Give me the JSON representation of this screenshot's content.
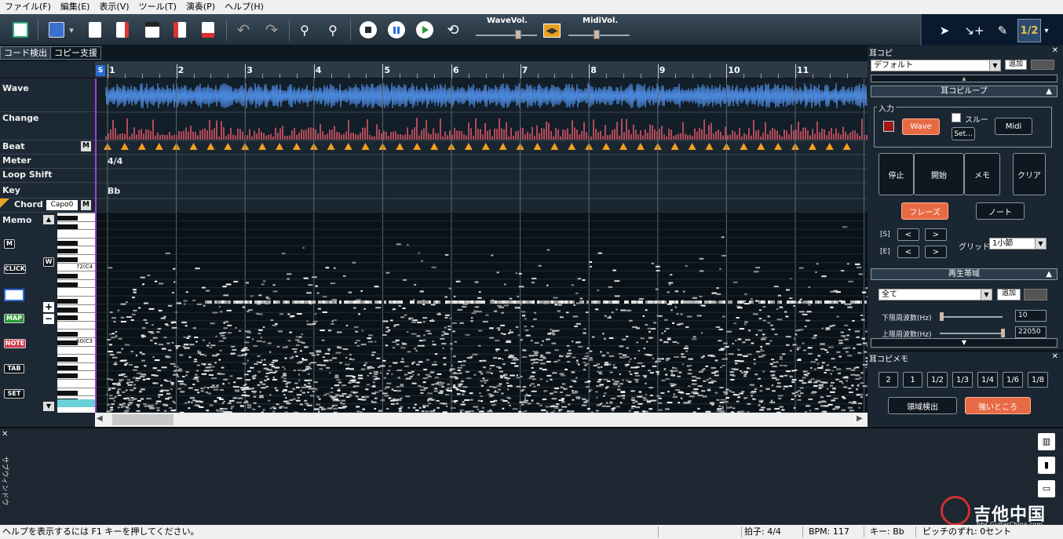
{
  "menu": [
    "ファイル(F)",
    "編集(E)",
    "表示(V)",
    "ツール(T)",
    "演奏(P)",
    "ヘルプ(H)"
  ],
  "toolbar": {
    "wave_vol_label": "WaveVol.",
    "midi_vol_label": "MidiVol.",
    "wave_vol_level": 0.72,
    "midi_vol_level": 0.45
  },
  "right_tools": {
    "half_label": "1/2"
  },
  "tabs": [
    "コード検出",
    "コピー支援"
  ],
  "ruler": {
    "start_marker": "S",
    "measures": [
      "1",
      "2",
      "3",
      "4",
      "5",
      "6",
      "7",
      "8",
      "9",
      "10",
      "11"
    ]
  },
  "tracks": {
    "wave": "Wave",
    "change": "Change",
    "beat": "Beat",
    "meter": "Meter",
    "loop_shift": "Loop Shift",
    "key": "Key",
    "chord": "Chord",
    "capo": "Capo0",
    "memo": "Memo",
    "m_label": "M",
    "meter_value": "4/4",
    "key_value": "Bb"
  },
  "side_buttons": {
    "m": "M",
    "w": "W",
    "click": "CLICK",
    "map": "MAP",
    "note": "NOTE",
    "tab": "TAB",
    "set": "SET",
    "plus": "+",
    "minus": "−"
  },
  "piano": {
    "c4": "72(C4",
    "c3": "60(C3"
  },
  "colors": {
    "wave": "#4a86d8",
    "change": "#e85a6a",
    "beat": "#f0a020",
    "accent": "#e86a44"
  },
  "mimicopi": {
    "title": "耳コピ",
    "preset": "デフォルト",
    "add": "追加",
    "loop_title": "耳コピループ",
    "input_label": "入力",
    "wave_btn": "Wave",
    "through_label": "スルー",
    "set_btn": "Set...",
    "midi_btn": "Midi",
    "stop": "停止",
    "start": "開始",
    "memo": "メモ",
    "clear": "クリア",
    "phrase": "フレーズ",
    "note": "ノート",
    "s_label": "[S]",
    "e_label": "[E]",
    "prev": "<",
    "next": ">",
    "grid_label": "グリッド",
    "grid_value": "1小節",
    "band_title": "再生帯域",
    "band_value": "全て",
    "band_add": "追加",
    "low_label": "下限周波数(Hz)",
    "low_value": "10",
    "high_label": "上限周波数(Hz)",
    "high_value": "22050"
  },
  "memo_panel": {
    "title": "耳コピメモ",
    "fractions": [
      "2",
      "1",
      "1/2",
      "1/3",
      "1/4",
      "1/6",
      "1/8"
    ],
    "detect": "領域検出",
    "strong": "強いところ"
  },
  "subwindow": {
    "title": "サブウィンドウ"
  },
  "watermark": {
    "text": "吉他中国",
    "url": "bbs.GuitarChina.com"
  },
  "status": {
    "help": "ヘルプを表示するには F1 キーを押してください。",
    "meter": "拍子: 4/4",
    "bpm": "BPM: 117",
    "key": "キー: Bb",
    "pitch": "ピッチのずれ: 0セント"
  }
}
